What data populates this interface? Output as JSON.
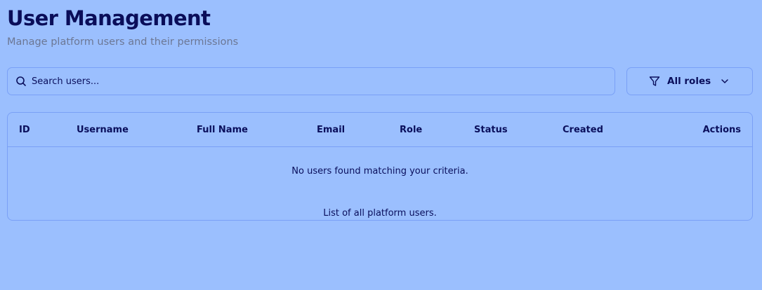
{
  "header": {
    "title": "User Management",
    "subtitle": "Manage platform users and their permissions"
  },
  "search": {
    "placeholder": "Search users...",
    "icon": "search-icon"
  },
  "filter": {
    "label": "All roles",
    "icon": "filter-icon",
    "chevron": "chevron-down-icon"
  },
  "table": {
    "columns": [
      "ID",
      "Username",
      "Full Name",
      "Email",
      "Role",
      "Status",
      "Created",
      "Actions"
    ],
    "empty_message": "No users found matching your criteria.",
    "caption": "List of all platform users."
  },
  "colors": {
    "background": "#9bbffe",
    "text": "#0a0f5c",
    "border": "#7aa0f6",
    "subtitle": "#6c7794"
  }
}
